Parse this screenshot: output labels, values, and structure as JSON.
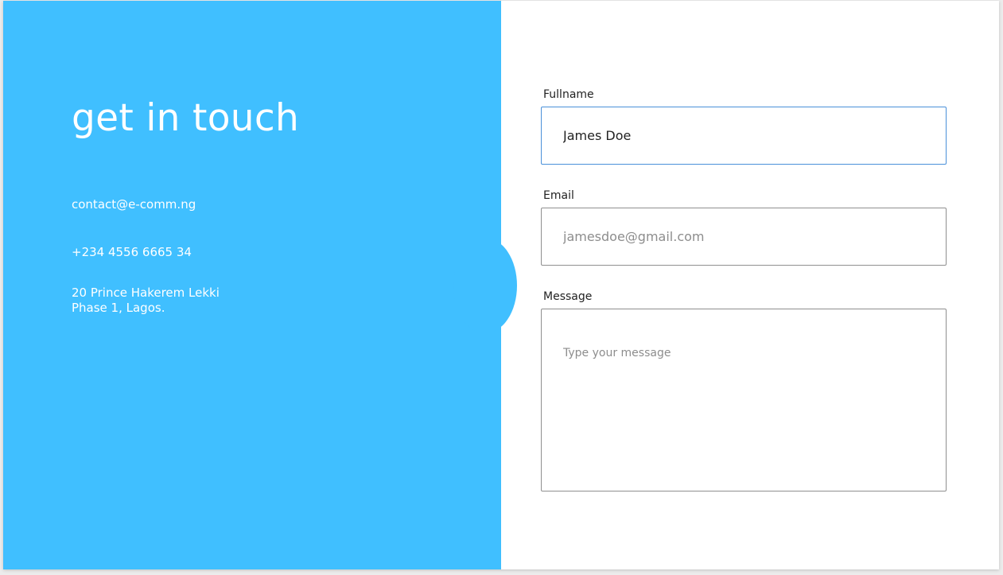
{
  "contact": {
    "heading": "get in touch",
    "email": "contact@e-comm.ng",
    "phone": "+234 4556 6665 34",
    "address_line1": "20 Prince Hakerem Lekki",
    "address_line2": "Phase 1, Lagos."
  },
  "form": {
    "fullname_label": "Fullname",
    "fullname_value": "James Doe",
    "email_label": "Email",
    "email_placeholder": "jamesdoe@gmail.com",
    "message_label": "Message",
    "message_placeholder": "Type your message"
  },
  "colors": {
    "accent": "#40bfff",
    "focus_border": "#4a90d9"
  }
}
